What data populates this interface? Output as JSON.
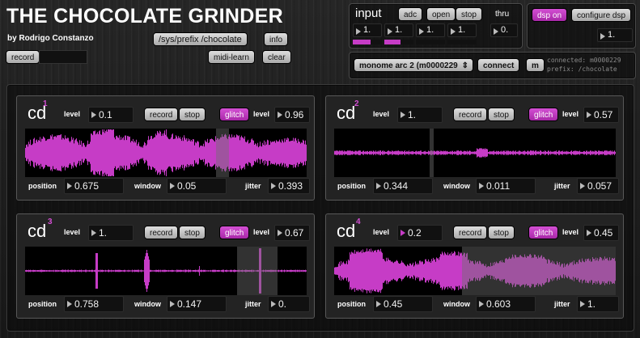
{
  "app": {
    "title": "THE CHOCOLATE GRINDER",
    "author": "by Rodrigo Constanzo",
    "prefix_path": "/sys/prefix /chocolate",
    "info_label": "info",
    "record_label": "record",
    "midi_learn_label": "midi-learn",
    "clear_label": "clear"
  },
  "input": {
    "title": "input",
    "adc_label": "adc",
    "open_label": "open",
    "stop_label": "stop",
    "thru_label": "thru",
    "levels": [
      "1.",
      "1.",
      "1.",
      "1."
    ],
    "thru_value": "0."
  },
  "dsp": {
    "dsp_on_label": "dsp on",
    "configure_label": "configure dsp",
    "value": "1."
  },
  "monome": {
    "device": "monome arc 2 (m0000229",
    "connect_label": "connect",
    "m_label": "m",
    "status_line1": "connected: m0000229",
    "status_line2": "prefix: /chocolate"
  },
  "labels": {
    "level": "level",
    "record": "record",
    "stop": "stop",
    "glitch": "glitch",
    "position": "position",
    "window": "window",
    "jitter": "jitter"
  },
  "colors": {
    "accent": "#c63cc6",
    "waveform": "#c63cc6",
    "background": "#1d1d1d"
  },
  "cds": [
    {
      "name": "cd",
      "number": "1",
      "level": "0.1",
      "glitch_level": "0.96",
      "position": "0.675",
      "window": "0.05",
      "jitter": "0.393"
    },
    {
      "name": "cd",
      "number": "2",
      "level": "1.",
      "glitch_level": "0.57",
      "position": "0.344",
      "window": "0.011",
      "jitter": "0.057"
    },
    {
      "name": "cd",
      "number": "3",
      "level": "1.",
      "glitch_level": "0.67",
      "position": "0.758",
      "window": "0.147",
      "jitter": "0."
    },
    {
      "name": "cd",
      "number": "4",
      "level": "0.2",
      "glitch_level": "0.45",
      "position": "0.45",
      "window": "0.603",
      "jitter": "1."
    }
  ]
}
